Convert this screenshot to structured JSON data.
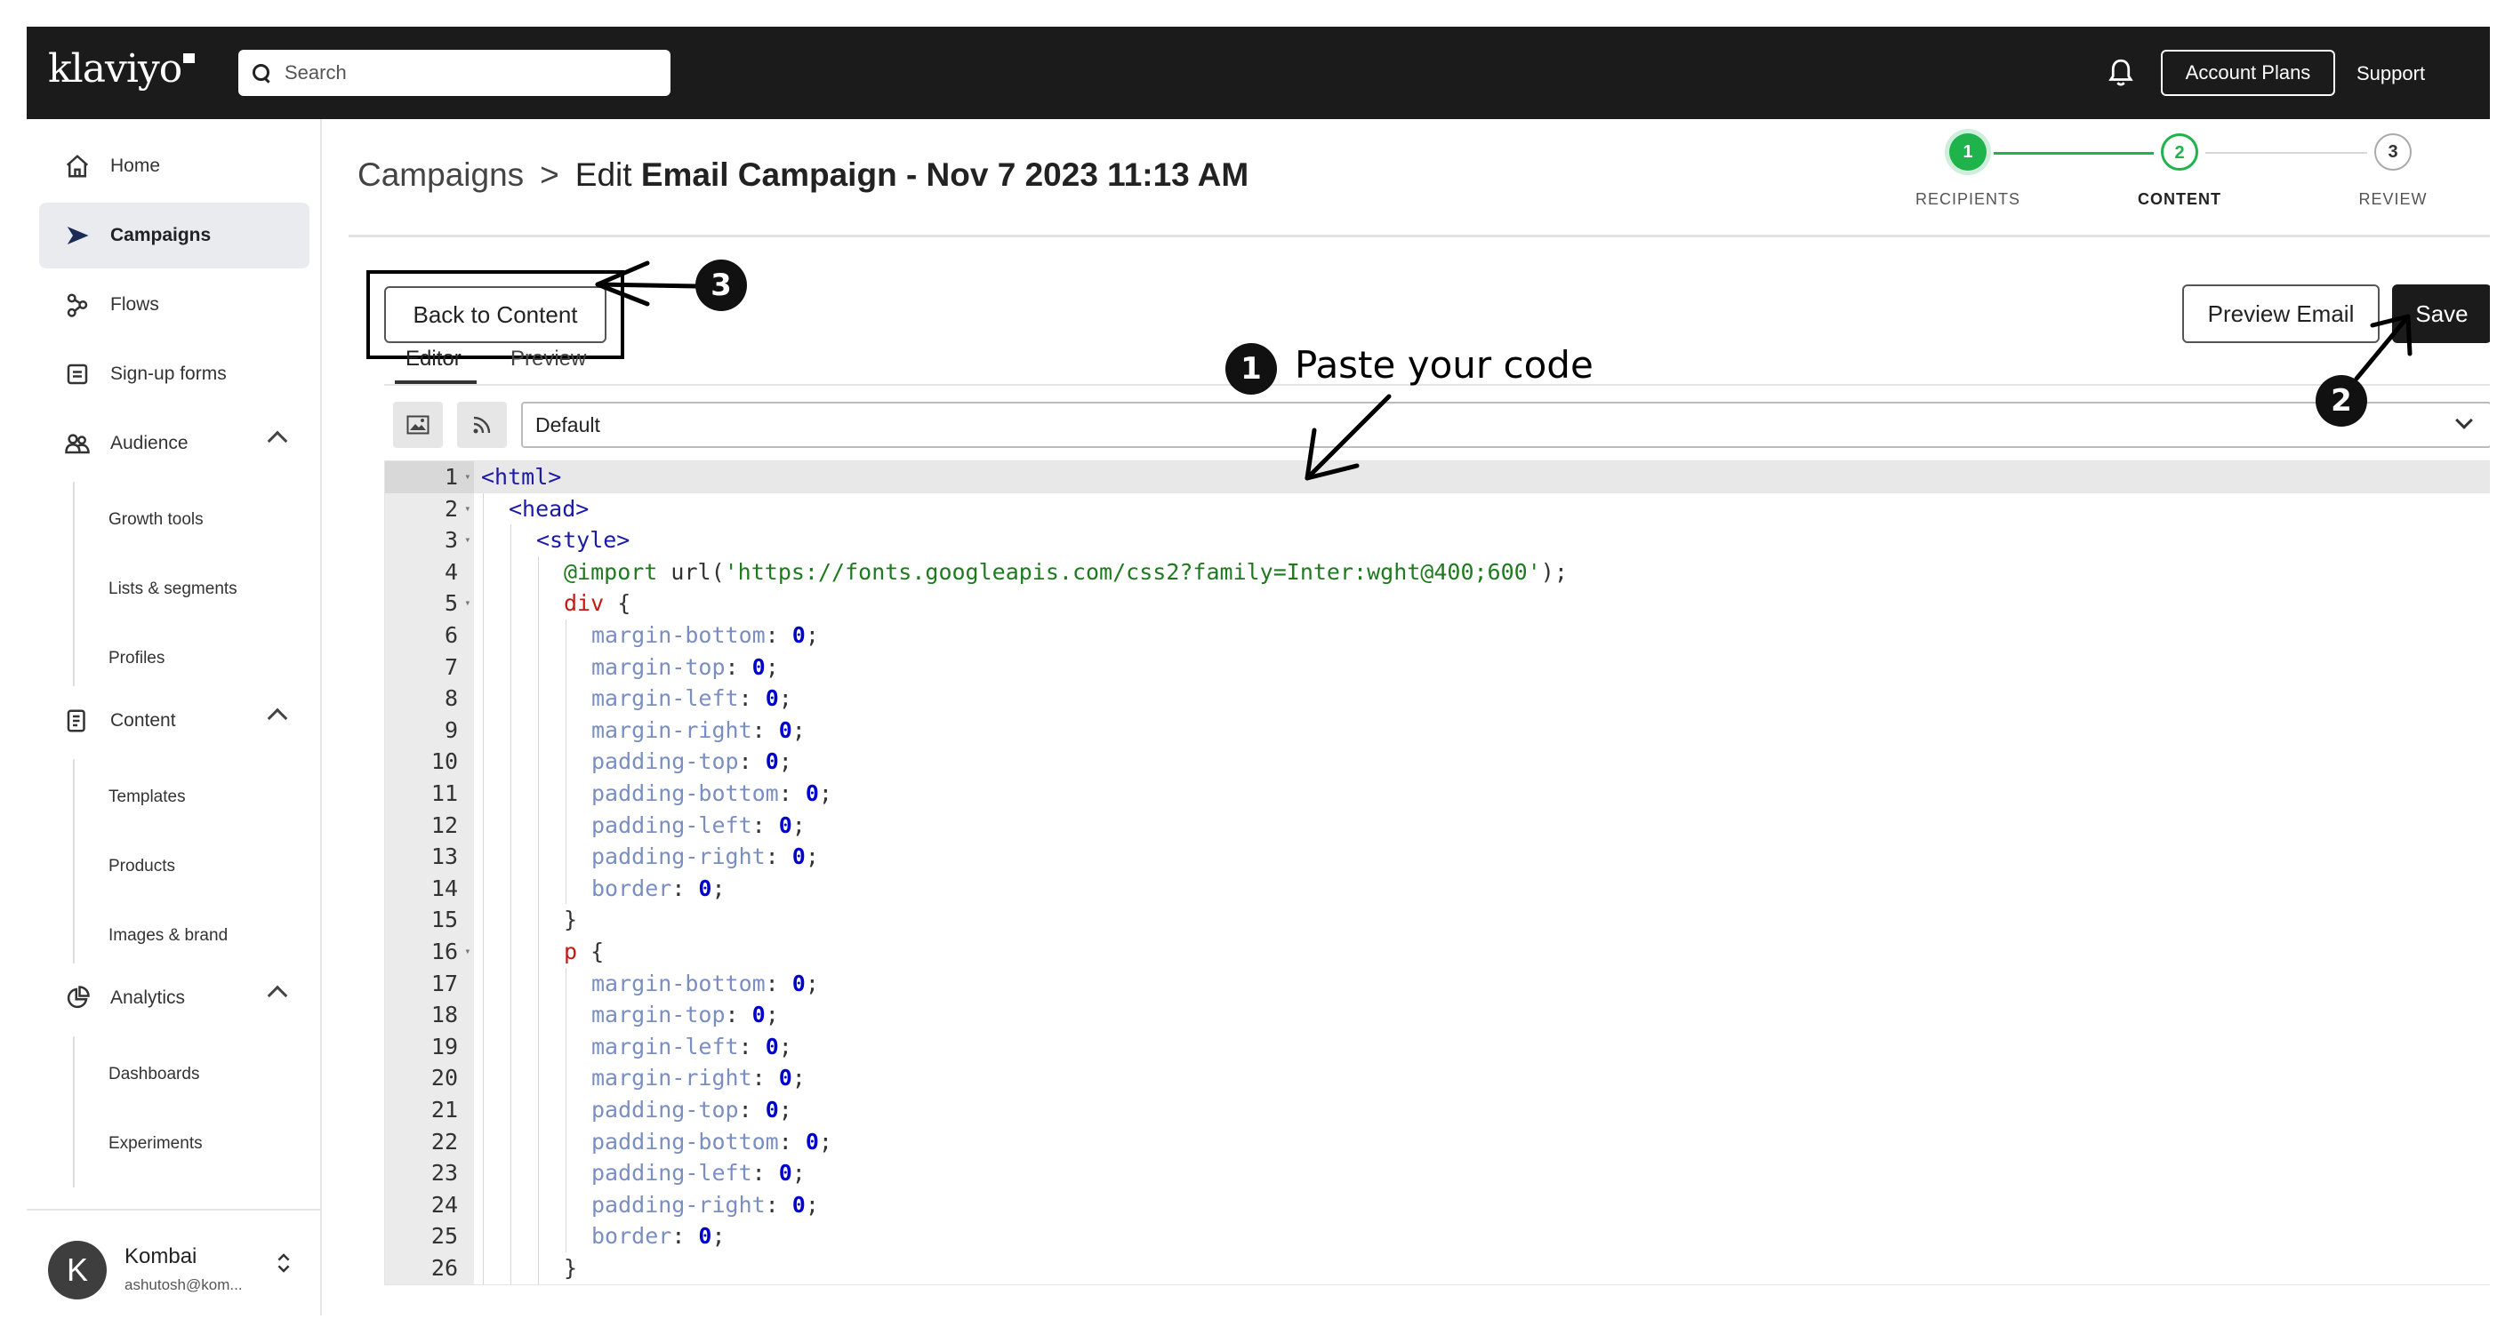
{
  "app": {
    "logo_text": "klaviyo",
    "search_placeholder": "Search",
    "account_plans_label": "Account Plans",
    "support_label": "Support"
  },
  "sidebar": {
    "items": [
      {
        "label": "Home",
        "icon": "home-icon"
      },
      {
        "label": "Campaigns",
        "icon": "campaigns-icon",
        "active": true
      },
      {
        "label": "Flows",
        "icon": "flows-icon"
      },
      {
        "label": "Sign-up forms",
        "icon": "signup-forms-icon"
      },
      {
        "label": "Audience",
        "icon": "audience-icon"
      },
      {
        "label": "Content",
        "icon": "content-icon"
      },
      {
        "label": "Analytics",
        "icon": "analytics-icon"
      }
    ],
    "audience_sub": [
      "Growth tools",
      "Lists & segments",
      "Profiles"
    ],
    "content_sub": [
      "Templates",
      "Products",
      "Images & brand"
    ],
    "analytics_sub": [
      "Dashboards",
      "Experiments"
    ],
    "account": {
      "initial": "K",
      "name": "Kombai",
      "email": "ashutosh@kom..."
    }
  },
  "header": {
    "breadcrumb_root": "Campaigns",
    "breadcrumb_sep": ">",
    "title_prefix": "Edit",
    "title_bold": "Email Campaign - Nov 7 2023 11:13 AM"
  },
  "stepper": {
    "steps": [
      {
        "number": "1",
        "label": "RECIPIENTS",
        "state": "complete"
      },
      {
        "number": "2",
        "label": "CONTENT",
        "state": "current"
      },
      {
        "number": "3",
        "label": "REVIEW",
        "state": "upcoming"
      }
    ],
    "complete_color": "#1fb34c"
  },
  "toolbar": {
    "back_label": "Back to Content",
    "preview_label": "Preview Email",
    "save_label": "Save"
  },
  "tabs": [
    {
      "label": "Editor",
      "active": true
    },
    {
      "label": "Preview",
      "active": false
    }
  ],
  "editor": {
    "template_select": "Default",
    "lines": [
      {
        "n": "1",
        "fold": true
      },
      {
        "n": "2",
        "fold": true
      },
      {
        "n": "3",
        "fold": true
      },
      {
        "n": "4"
      },
      {
        "n": "5",
        "fold": true
      },
      {
        "n": "6"
      },
      {
        "n": "7"
      },
      {
        "n": "8"
      },
      {
        "n": "9"
      },
      {
        "n": "10"
      },
      {
        "n": "11"
      },
      {
        "n": "12"
      },
      {
        "n": "13"
      },
      {
        "n": "14"
      },
      {
        "n": "15"
      },
      {
        "n": "16",
        "fold": true
      },
      {
        "n": "17"
      },
      {
        "n": "18"
      },
      {
        "n": "19"
      },
      {
        "n": "20"
      },
      {
        "n": "21"
      },
      {
        "n": "22"
      },
      {
        "n": "23"
      },
      {
        "n": "24"
      },
      {
        "n": "25"
      },
      {
        "n": "26"
      }
    ],
    "code": {
      "l1": "<html>",
      "l2": "<head>",
      "l3": "<style>",
      "l4_at": "@import",
      "l4_fn": " url(",
      "l4_str": "'https://fonts.googleapis.com/css2?family=Inter:wght@400;600'",
      "l4_end": ");",
      "sel_div": "div",
      "sel_p": "p",
      "brace_open": " {",
      "brace_close": "}",
      "props": [
        "margin-bottom",
        "margin-top",
        "margin-left",
        "margin-right",
        "padding-top",
        "padding-bottom",
        "padding-left",
        "padding-right",
        "border"
      ],
      "colon": ": ",
      "zero": "0",
      "semi": ";"
    }
  },
  "help_label": "?",
  "annotations": {
    "step1_number": "1",
    "step1_text": "Paste your code",
    "step2_number": "2",
    "step3_number": "3"
  }
}
